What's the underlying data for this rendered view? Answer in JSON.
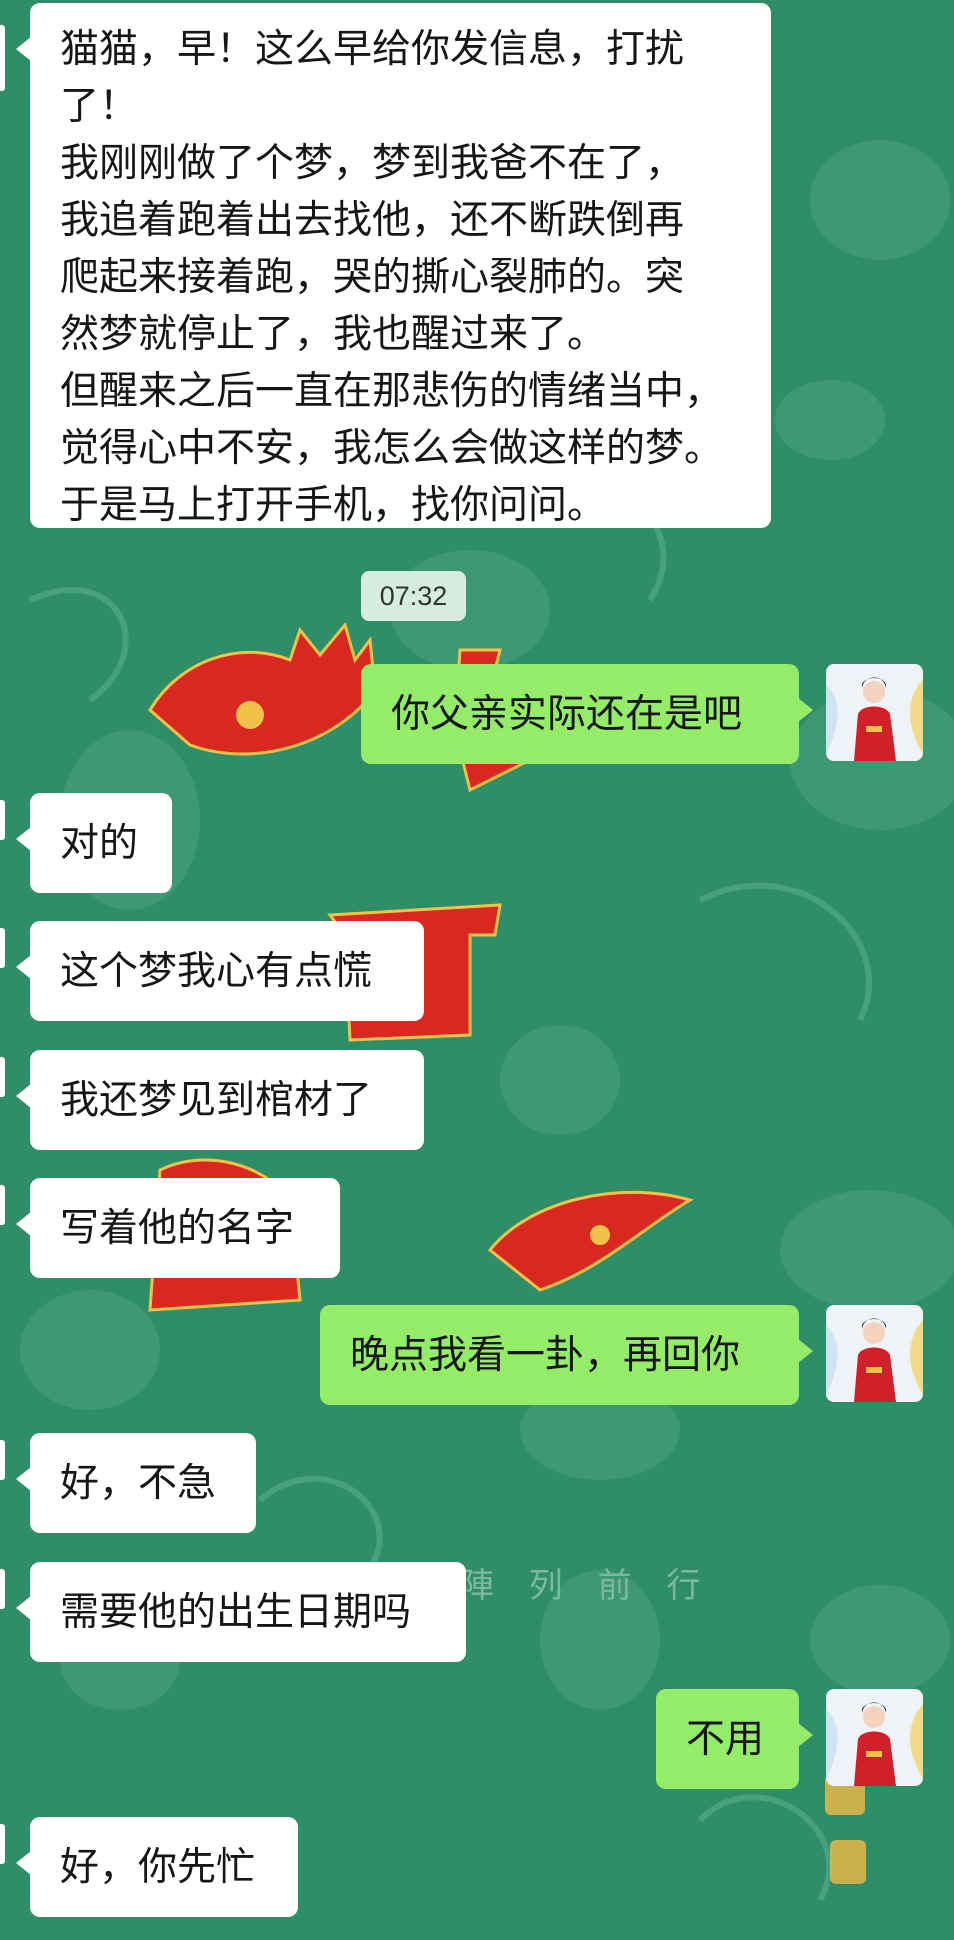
{
  "chat": {
    "timestamp": "07:32",
    "background_watermark": "陣 列 前 行",
    "colors": {
      "background": "#2f8e68",
      "incoming_bubble": "#ffffff",
      "outgoing_bubble": "#95ec69",
      "emblem_red": "#d9281f"
    },
    "messages": [
      {
        "direction": "incoming",
        "lines": [
          "猫猫，早！这么早给你发信息，打扰",
          "了！",
          "我刚刚做了个梦，梦到我爸不在了，",
          "我追着跑着出去找他，还不断跌倒再",
          "爬起来接着跑，哭的撕心裂肺的。突",
          "然梦就停止了，我也醒过来了。",
          "但醒来之后一直在那悲伤的情绪当中，",
          "觉得心中不安，我怎么会做这样的梦。",
          "于是马上打开手机，找你问问。"
        ]
      },
      {
        "direction": "outgoing",
        "text": "你父亲实际还在是吧",
        "avatar": "user-avatar"
      },
      {
        "direction": "incoming",
        "text": "对的"
      },
      {
        "direction": "incoming",
        "text": "这个梦我心有点慌"
      },
      {
        "direction": "incoming",
        "text": "我还梦见到棺材了"
      },
      {
        "direction": "incoming",
        "text": "写着他的名字"
      },
      {
        "direction": "outgoing",
        "text": "晚点我看一卦，再回你",
        "avatar": "user-avatar"
      },
      {
        "direction": "incoming",
        "text": "好，不急"
      },
      {
        "direction": "incoming",
        "text": "需要他的出生日期吗"
      },
      {
        "direction": "outgoing",
        "text": "不用",
        "avatar": "user-avatar"
      },
      {
        "direction": "incoming",
        "text": "好，你先忙"
      }
    ]
  }
}
